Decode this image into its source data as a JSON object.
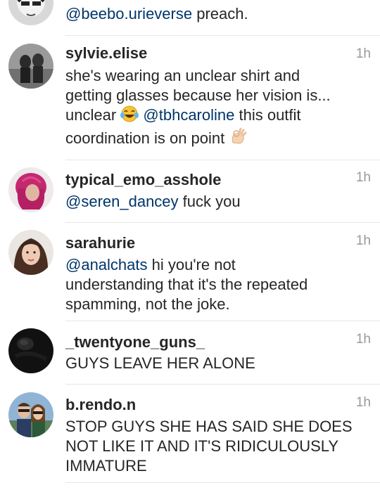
{
  "comments": [
    {
      "username": "",
      "time": "",
      "mention": "@beebo.urieverse",
      "text": " preach."
    },
    {
      "username": "sylvie.elise",
      "time": "1h",
      "line1": "she's wearing an unclear shirt and",
      "line2": "getting glasses because her vision is...",
      "line3_pre": "unclear ",
      "mention": "@tbhcaroline",
      "line3_post": " this outfit",
      "line4": "coordination is on point "
    },
    {
      "username": "typical_emo_asshole",
      "time": "1h",
      "mention": "@seren_dancey",
      "text": " fuck you"
    },
    {
      "username": "sarahurie",
      "time": "1h",
      "mention": "@analchats",
      "line1_post": " hi you're not",
      "line2": "understanding that it's the repeated",
      "line3": "spamming, not the joke."
    },
    {
      "username": "_twentyone_guns_",
      "time": "1h",
      "text": "GUYS LEAVE HER ALONE"
    },
    {
      "username": "b.rendo.n",
      "time": "1h",
      "line1": "STOP GUYS SHE HAS SAID SHE DOES",
      "line2": "NOT LIKE IT AND IT'S RIDICULOUSLY",
      "line3": "IMMATURE"
    }
  ],
  "icons": {
    "laughing": "face-with-tears-of-joy-icon",
    "ok_hand": "ok-hand-icon"
  }
}
